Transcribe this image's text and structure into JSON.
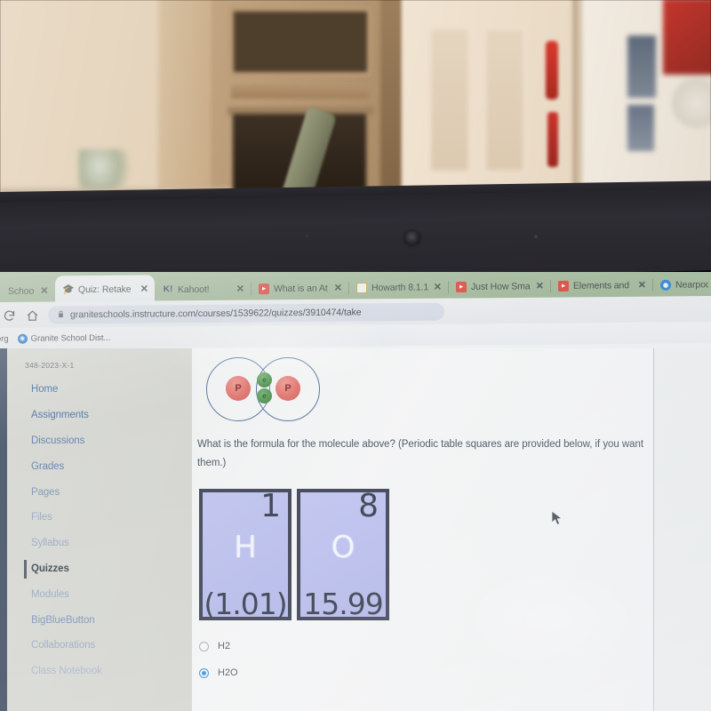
{
  "browser": {
    "tabs": [
      {
        "label": "Schoo",
        "favicon": "none",
        "active": false,
        "closeable": true
      },
      {
        "label": "Quiz: Retake P",
        "favicon": "canvas-icon",
        "active": true,
        "closeable": true
      },
      {
        "label": "Kahoot!",
        "favicon": "kahoot-icon",
        "active": false,
        "closeable": true
      },
      {
        "label": "What is an At",
        "favicon": "youtube-icon",
        "active": false,
        "closeable": true
      },
      {
        "label": "Howarth 8.1.1",
        "favicon": "document-icon",
        "active": false,
        "closeable": true
      },
      {
        "label": "Just How Sma",
        "favicon": "youtube-icon",
        "active": false,
        "closeable": true
      },
      {
        "label": "Elements and",
        "favicon": "youtube-icon",
        "active": false,
        "closeable": true
      },
      {
        "label": "Nearpod -",
        "favicon": "nearpod-icon",
        "active": false,
        "closeable": false
      }
    ],
    "close_glyph": "✕",
    "toolbar": {
      "reload_icon": "reload-icon",
      "home_icon": "home-icon",
      "lock_glyph": "🔒",
      "url": "graniteschools.instructure.com/courses/1539622/quizzes/3910474/take"
    },
    "bookmarks": [
      {
        "label": "d.org",
        "icon": "none"
      },
      {
        "label": "Granite School Dist...",
        "icon": "globe-icon"
      }
    ]
  },
  "canvas": {
    "course_code": "348-2023-X-1",
    "nav_items": [
      {
        "label": "Home",
        "current": false
      },
      {
        "label": "Assignments",
        "current": false
      },
      {
        "label": "Discussions",
        "current": false
      },
      {
        "label": "Grades",
        "current": false
      },
      {
        "label": "Pages",
        "current": false
      },
      {
        "label": "Files",
        "current": false
      },
      {
        "label": "Syllabus",
        "current": false
      },
      {
        "label": "Quizzes",
        "current": true
      },
      {
        "label": "Modules",
        "current": false
      },
      {
        "label": "BigBlueButton",
        "current": false
      },
      {
        "label": "Collaborations",
        "current": false
      },
      {
        "label": "Class Notebook",
        "current": false
      }
    ]
  },
  "quiz": {
    "diagram": {
      "name": "covalent-bond-diagram",
      "proton_label": "P",
      "electron_label": "e",
      "proton_count": 2,
      "electron_count": 2,
      "proton_color": "#dd5a54",
      "electron_color": "#3c8a3c",
      "orbital_color": "#3d5f96"
    },
    "question_text": "What is the formula for the molecule above? (Periodic table squares are provided below, if you want them.)",
    "element_squares": [
      {
        "atomic_number": "1",
        "symbol": "H",
        "mass": "(1.01)"
      },
      {
        "atomic_number": "8",
        "symbol": "O",
        "mass": "15.99"
      }
    ],
    "options": [
      {
        "label": "H2",
        "selected": false
      },
      {
        "label": "H2O",
        "selected": true
      }
    ]
  },
  "colors": {
    "tab_strip": "#95af8d",
    "canvas_link": "#2f5b9c",
    "selected_radio": "#1f85d6",
    "element_tile_bg": "#b1b7ec",
    "element_tile_border": "#22263c"
  }
}
